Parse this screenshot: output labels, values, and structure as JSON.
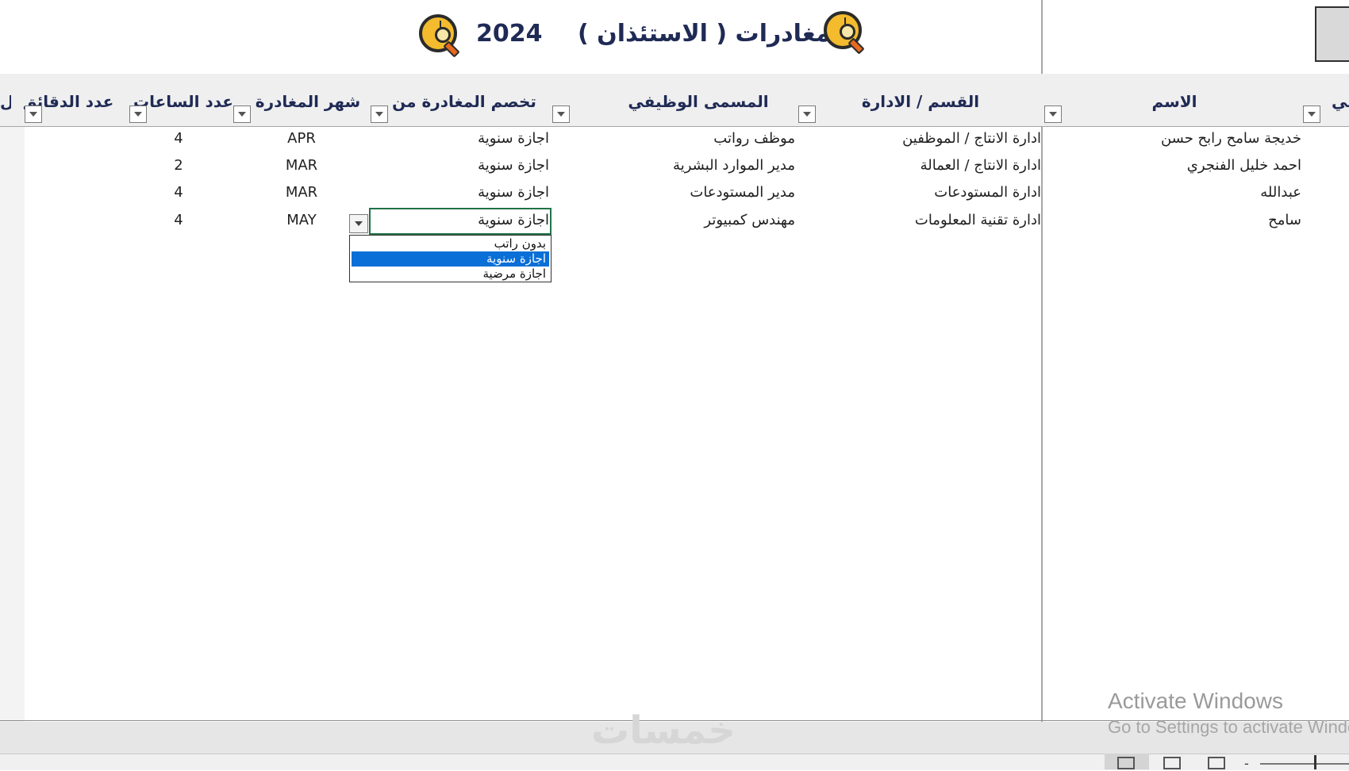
{
  "title": {
    "text": "المغادرات ( الاستئذان )",
    "year": "2024"
  },
  "headers": {
    "job_partial": "في",
    "name": "الاسم",
    "department": "القسم / الادارة",
    "job_title": "المسمى الوظيفي",
    "deduct_from": "تخصم المغادرة من",
    "month": "شهر المغادرة",
    "hours": "عدد الساعات",
    "minutes": "عدد الدقائق",
    "last_partial": "ال"
  },
  "rows": [
    {
      "name": "خديجة سامح رابح حسن",
      "department": "ادارة الانتاج / الموظفين",
      "job_title": "موظف رواتب",
      "deduct_from": "اجازة سنوية",
      "month": "APR",
      "hours": "4"
    },
    {
      "name": "احمد خليل الفنجري",
      "department": "ادارة الانتاج / العمالة",
      "job_title": "مدير الموارد البشرية",
      "deduct_from": "اجازة سنوية",
      "month": "MAR",
      "hours": "2"
    },
    {
      "name": "عبدالله",
      "department": "ادارة المستودعات",
      "job_title": "مدير المستودعات",
      "deduct_from": "اجازة سنوية",
      "month": "MAR",
      "hours": "4"
    },
    {
      "name": "سامح",
      "department": "ادارة تقنية المعلومات",
      "job_title": "مهندس كمبيوتر",
      "deduct_from": "اجازة سنوية",
      "month": "MAY",
      "hours": "4"
    }
  ],
  "dropdown": {
    "options": [
      "بدون راتب",
      "اجازة سنوية",
      "اجازة مرضية"
    ],
    "selected": "اجازة سنوية"
  },
  "watermarks": {
    "activate_title": "Activate Windows",
    "activate_sub": "Go to Settings to activate Windows.",
    "site": "خمسات"
  },
  "colors": {
    "title_text": "#1f2a55",
    "active_cell_border": "#217346",
    "selected_option": "#0a6fd6",
    "icon_gold": "#f3bb2d"
  },
  "icons": {
    "title_left": "clock-magnifier-icon",
    "title_right": "clock-magnifier-icon",
    "filter": "filter-dropdown-icon",
    "view_normal": "normal-view-icon",
    "view_page_layout": "page-layout-view-icon",
    "view_page_break": "page-break-view-icon"
  }
}
